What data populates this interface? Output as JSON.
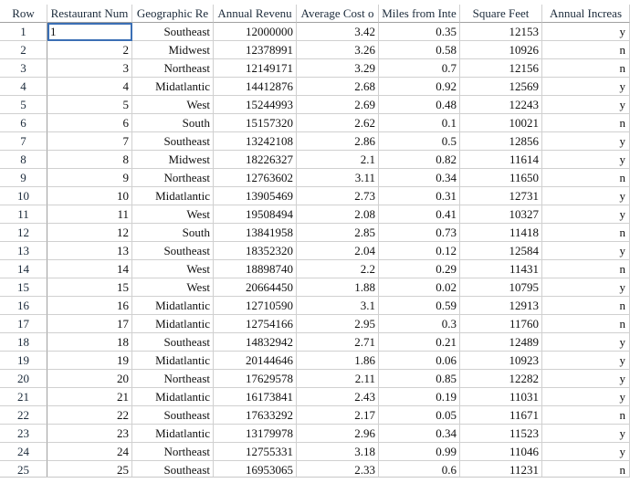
{
  "columns": [
    "Row",
    "Restaurant Num",
    "Geographic Re",
    "Annual Revenu",
    "Average Cost o",
    "Miles from Inte",
    "Square Feet",
    "Annual Increas"
  ],
  "selected_cell_value": "1",
  "rows": [
    [
      "1",
      "1",
      "Southeast",
      "12000000",
      "3.42",
      "0.35",
      "12153",
      "y"
    ],
    [
      "2",
      "2",
      "Midwest",
      "12378991",
      "3.26",
      "0.58",
      "10926",
      "n"
    ],
    [
      "3",
      "3",
      "Northeast",
      "12149171",
      "3.29",
      "0.7",
      "12156",
      "n"
    ],
    [
      "4",
      "4",
      "Midatlantic",
      "14412876",
      "2.68",
      "0.92",
      "12569",
      "y"
    ],
    [
      "5",
      "5",
      "West",
      "15244993",
      "2.69",
      "0.48",
      "12243",
      "y"
    ],
    [
      "6",
      "6",
      "South",
      "15157320",
      "2.62",
      "0.1",
      "10021",
      "n"
    ],
    [
      "7",
      "7",
      "Southeast",
      "13242108",
      "2.86",
      "0.5",
      "12856",
      "y"
    ],
    [
      "8",
      "8",
      "Midwest",
      "18226327",
      "2.1",
      "0.82",
      "11614",
      "y"
    ],
    [
      "9",
      "9",
      "Northeast",
      "12763602",
      "3.11",
      "0.34",
      "11650",
      "n"
    ],
    [
      "10",
      "10",
      "Midatlantic",
      "13905469",
      "2.73",
      "0.31",
      "12731",
      "y"
    ],
    [
      "11",
      "11",
      "West",
      "19508494",
      "2.08",
      "0.41",
      "10327",
      "y"
    ],
    [
      "12",
      "12",
      "South",
      "13841958",
      "2.85",
      "0.73",
      "11418",
      "n"
    ],
    [
      "13",
      "13",
      "Southeast",
      "18352320",
      "2.04",
      "0.12",
      "12584",
      "y"
    ],
    [
      "14",
      "14",
      "West",
      "18898740",
      "2.2",
      "0.29",
      "11431",
      "n"
    ],
    [
      "15",
      "15",
      "West",
      "20664450",
      "1.88",
      "0.02",
      "10795",
      "y"
    ],
    [
      "16",
      "16",
      "Midatlantic",
      "12710590",
      "3.1",
      "0.59",
      "12913",
      "n"
    ],
    [
      "17",
      "17",
      "Midatlantic",
      "12754166",
      "2.95",
      "0.3",
      "11760",
      "n"
    ],
    [
      "18",
      "18",
      "Southeast",
      "14832942",
      "2.71",
      "0.21",
      "12489",
      "y"
    ],
    [
      "19",
      "19",
      "Midatlantic",
      "20144646",
      "1.86",
      "0.06",
      "10923",
      "y"
    ],
    [
      "20",
      "20",
      "Northeast",
      "17629578",
      "2.11",
      "0.85",
      "12282",
      "y"
    ],
    [
      "21",
      "21",
      "Midatlantic",
      "16173841",
      "2.43",
      "0.19",
      "11031",
      "y"
    ],
    [
      "22",
      "22",
      "Southeast",
      "17633292",
      "2.17",
      "0.05",
      "11671",
      "n"
    ],
    [
      "23",
      "23",
      "Midatlantic",
      "13179978",
      "2.96",
      "0.34",
      "11523",
      "y"
    ],
    [
      "24",
      "24",
      "Northeast",
      "12755331",
      "3.18",
      "0.99",
      "11046",
      "y"
    ],
    [
      "25",
      "25",
      "Southeast",
      "16953065",
      "2.33",
      "0.6",
      "11231",
      "n"
    ]
  ]
}
